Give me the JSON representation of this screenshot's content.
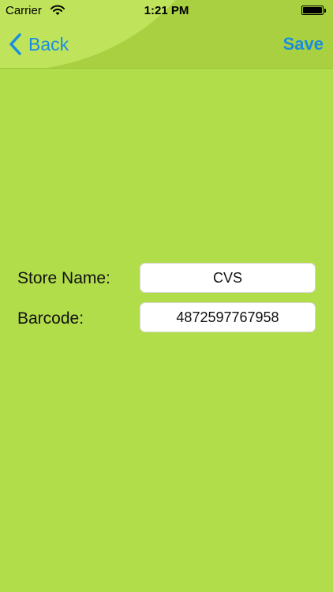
{
  "status_bar": {
    "carrier": "Carrier",
    "time": "1:21 PM",
    "wifi_icon": "wifi-icon",
    "battery_icon": "battery-icon"
  },
  "nav": {
    "back_label": "Back",
    "back_icon": "chevron-left-icon",
    "save_label": "Save"
  },
  "form": {
    "store_name_label": "Store Name:",
    "store_name_value": "CVS",
    "barcode_label": "Barcode:",
    "barcode_value": "4872597767958"
  },
  "colors": {
    "background": "#b2dd4b",
    "header": "#a9d040",
    "accent": "#1a8ddf"
  }
}
